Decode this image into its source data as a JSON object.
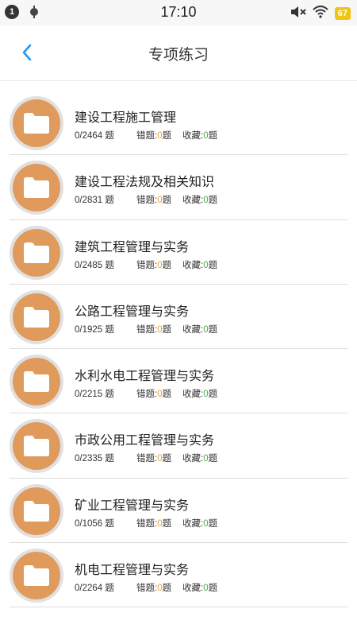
{
  "status_bar": {
    "notification_count": "1",
    "time": "17:10",
    "battery": "67",
    "icons": [
      "android-icon",
      "mute-icon",
      "wifi-icon",
      "battery-icon"
    ]
  },
  "header": {
    "title": "专项练习",
    "back_icon": "chevron-left-icon",
    "accent_color": "#2196f3"
  },
  "labels": {
    "question_unit": "题",
    "wrong_label": "错题:",
    "fav_label": "收藏:"
  },
  "items": [
    {
      "title": "建设工程施工管理",
      "progress": "0/2464",
      "wrong": "0",
      "fav": "0"
    },
    {
      "title": "建设工程法规及相关知识",
      "progress": "0/2831",
      "wrong": "0",
      "fav": "0"
    },
    {
      "title": "建筑工程管理与实务",
      "progress": "0/2485",
      "wrong": "0",
      "fav": "0"
    },
    {
      "title": "公路工程管理与实务",
      "progress": "0/1925",
      "wrong": "0",
      "fav": "0"
    },
    {
      "title": "水利水电工程管理与实务",
      "progress": "0/2215",
      "wrong": "0",
      "fav": "0"
    },
    {
      "title": "市政公用工程管理与实务",
      "progress": "0/2335",
      "wrong": "0",
      "fav": "0"
    },
    {
      "title": "矿业工程管理与实务",
      "progress": "0/1056",
      "wrong": "0",
      "fav": "0"
    },
    {
      "title": "机电工程管理与实务",
      "progress": "0/2264",
      "wrong": "0",
      "fav": "0"
    }
  ]
}
